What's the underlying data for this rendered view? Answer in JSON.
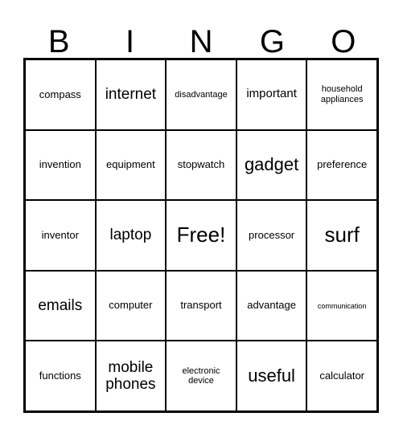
{
  "card": {
    "title": "BINGO",
    "header_letters": [
      "B",
      "I",
      "N",
      "G",
      "O"
    ],
    "grid_size": "5x5",
    "free_space": "Free!",
    "colors": {
      "background": "#ffffff",
      "text": "#000000",
      "grid_line": "#000000"
    },
    "rows": [
      [
        {
          "text": "compass",
          "size": "md"
        },
        {
          "text": "internet",
          "size": "xl"
        },
        {
          "text": "disadvantage",
          "size": "sm"
        },
        {
          "text": "important",
          "size": "lg"
        },
        {
          "text": "household appliances",
          "size": "sm"
        }
      ],
      [
        {
          "text": "invention",
          "size": "md"
        },
        {
          "text": "equipment",
          "size": "md"
        },
        {
          "text": "stopwatch",
          "size": "md"
        },
        {
          "text": "gadget",
          "size": "xxl"
        },
        {
          "text": "preference",
          "size": "md"
        }
      ],
      [
        {
          "text": "inventor",
          "size": "md"
        },
        {
          "text": "laptop",
          "size": "xl"
        },
        {
          "text": "Free!",
          "size": "huge"
        },
        {
          "text": "processor",
          "size": "md"
        },
        {
          "text": "surf",
          "size": "huge"
        }
      ],
      [
        {
          "text": "emails",
          "size": "xl"
        },
        {
          "text": "computer",
          "size": "md"
        },
        {
          "text": "transport",
          "size": "md"
        },
        {
          "text": "advantage",
          "size": "md"
        },
        {
          "text": "communication",
          "size": "xs"
        }
      ],
      [
        {
          "text": "functions",
          "size": "md"
        },
        {
          "text": "mobile phones",
          "size": "xl"
        },
        {
          "text": "electronic device",
          "size": "sm"
        },
        {
          "text": "useful",
          "size": "xxl"
        },
        {
          "text": "calculator",
          "size": "md"
        }
      ]
    ]
  }
}
